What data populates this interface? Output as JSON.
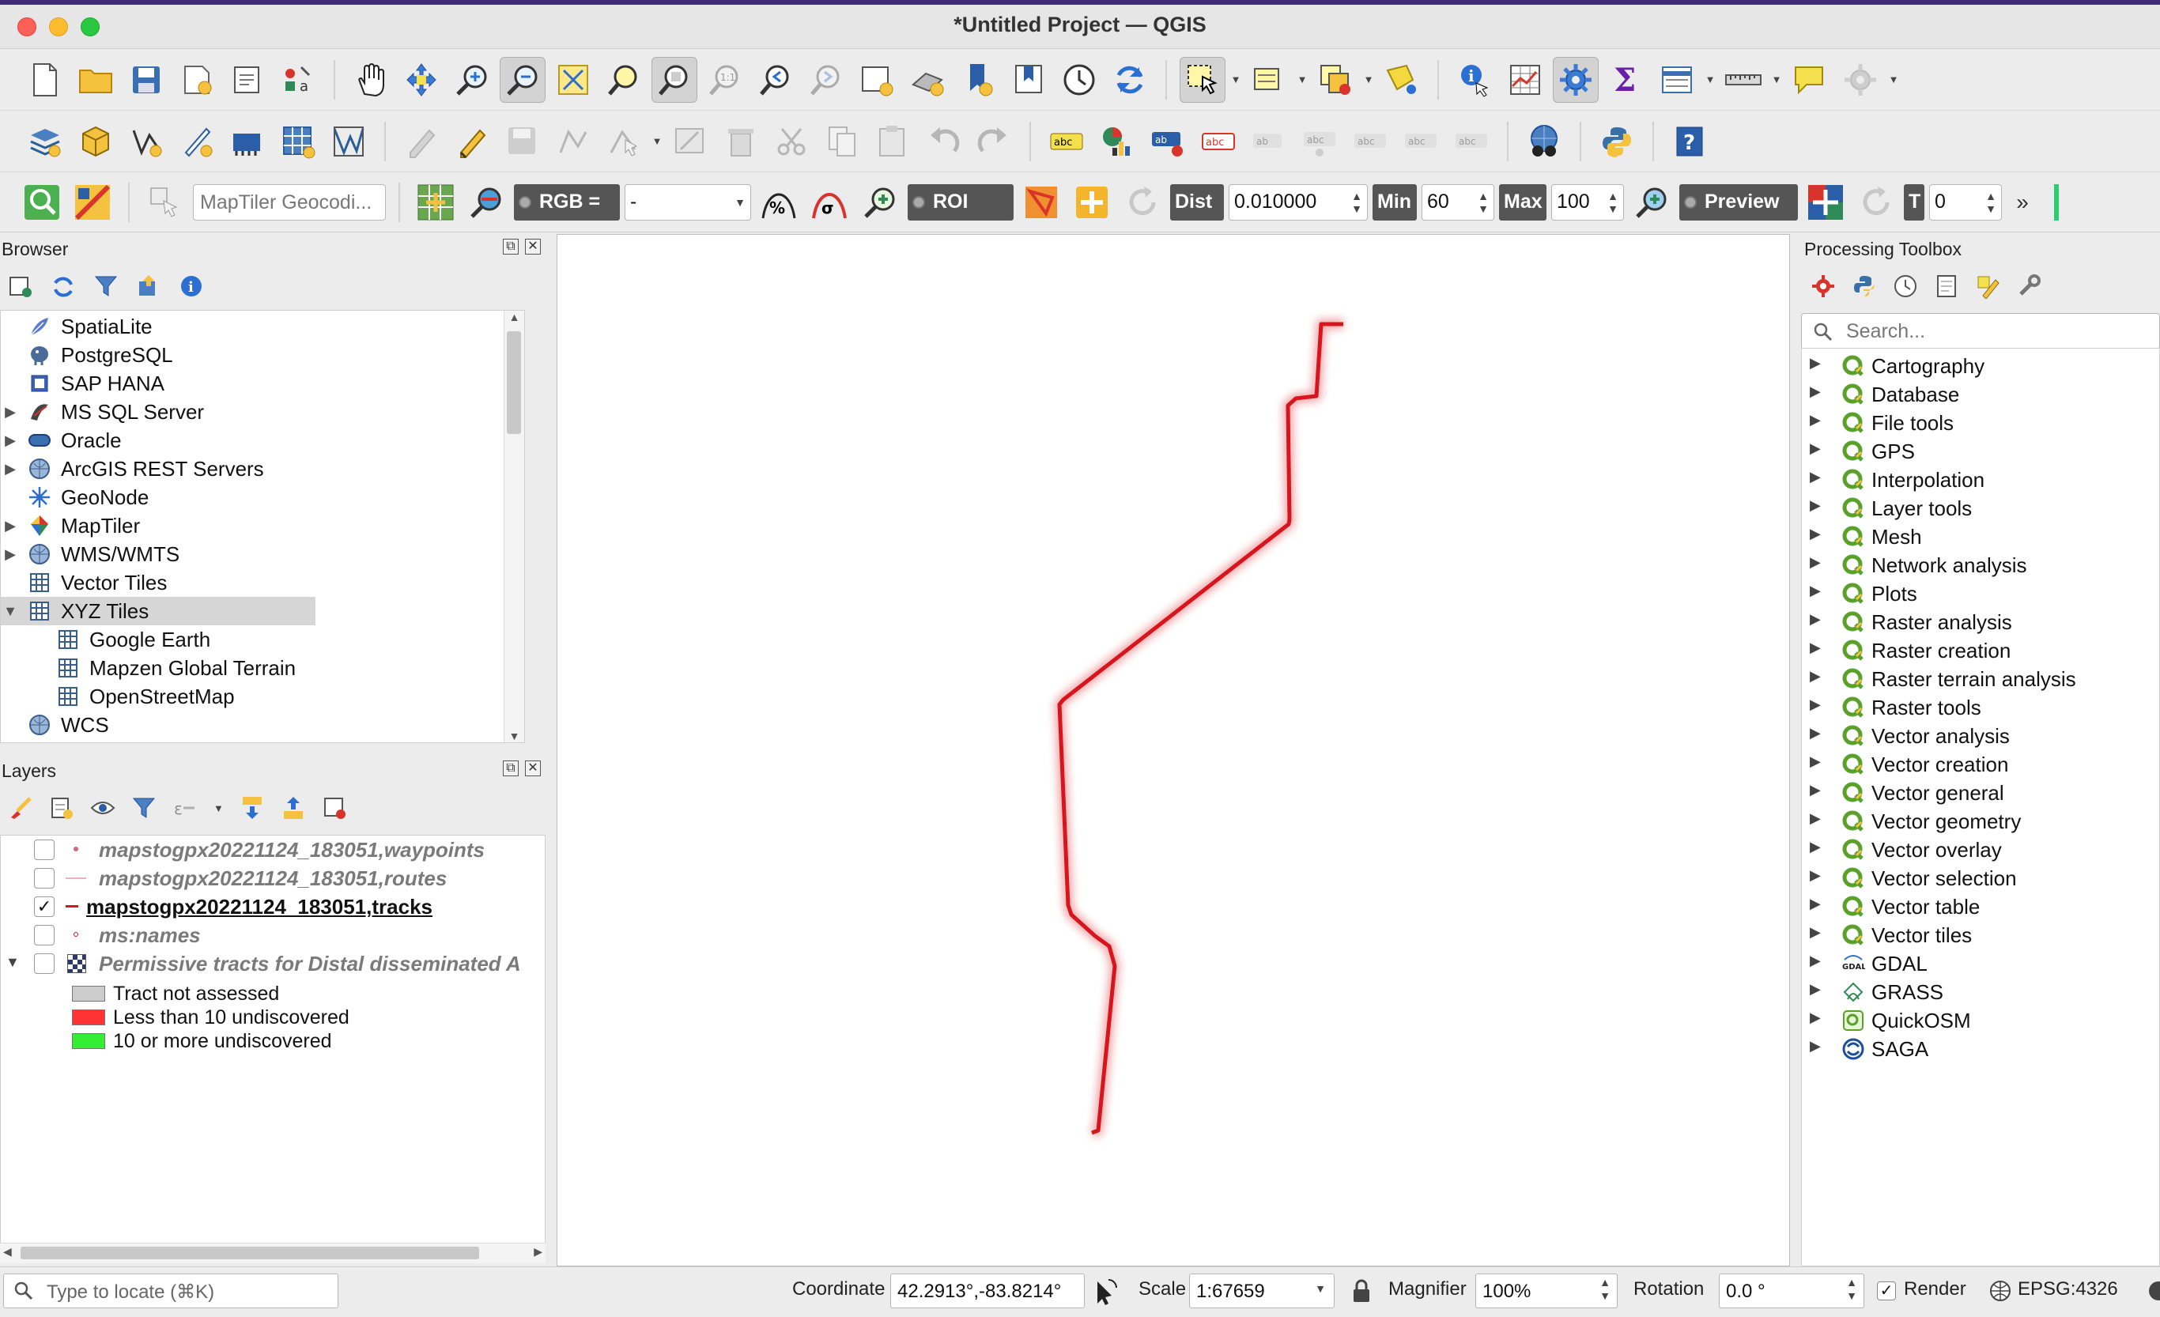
{
  "window": {
    "title": "*Untitled Project — QGIS"
  },
  "toolbar3": {
    "geocoder_placeholder": "MapTiler Geocodi...",
    "rgb_label": "RGB =",
    "rgb_value": "-",
    "roi_label": "ROI",
    "dist_label": "Dist",
    "dist_value": "0.010000",
    "min_label": "Min",
    "min_value": "60",
    "max_label": "Max",
    "max_value": "100",
    "preview_label": "Preview",
    "t_label": "T",
    "t_value": "0",
    "overflow": "»"
  },
  "browser": {
    "title": "Browser",
    "items": [
      {
        "label": "SpatiaLite",
        "icon": "feather-icon",
        "expandable": false,
        "indent": 0
      },
      {
        "label": "PostgreSQL",
        "icon": "elephant-icon",
        "expandable": false,
        "indent": 0
      },
      {
        "label": "SAP HANA",
        "icon": "database-icon",
        "expandable": false,
        "indent": 0
      },
      {
        "label": "MS SQL Server",
        "icon": "mssql-icon",
        "expandable": true,
        "indent": 0
      },
      {
        "label": "Oracle",
        "icon": "oracle-icon",
        "expandable": true,
        "indent": 0
      },
      {
        "label": "ArcGIS REST Servers",
        "icon": "globe-icon",
        "expandable": true,
        "indent": 0
      },
      {
        "label": "GeoNode",
        "icon": "geonode-icon",
        "expandable": false,
        "indent": 0
      },
      {
        "label": "MapTiler",
        "icon": "maptiler-icon",
        "expandable": true,
        "indent": 0
      },
      {
        "label": "WMS/WMTS",
        "icon": "globe-icon",
        "expandable": true,
        "indent": 0
      },
      {
        "label": "Vector Tiles",
        "icon": "grid-icon",
        "expandable": false,
        "indent": 0
      },
      {
        "label": "XYZ Tiles",
        "icon": "grid-icon",
        "expandable": true,
        "expanded": true,
        "selected": true,
        "indent": 0
      },
      {
        "label": "Google Earth",
        "icon": "grid-icon",
        "expandable": false,
        "indent": 1
      },
      {
        "label": "Mapzen Global Terrain",
        "icon": "grid-icon",
        "expandable": false,
        "indent": 1
      },
      {
        "label": "OpenStreetMap",
        "icon": "grid-icon",
        "expandable": false,
        "indent": 1
      },
      {
        "label": "WCS",
        "icon": "globe-icon",
        "expandable": false,
        "indent": 0
      }
    ]
  },
  "layers": {
    "title": "Layers",
    "items": [
      {
        "label": "mapstogpx20221124_183051,waypoints",
        "checked": false,
        "style": "dim",
        "symbol": "point-pink"
      },
      {
        "label": "mapstogpx20221124_183051,routes",
        "checked": false,
        "style": "dim",
        "symbol": "line-pink"
      },
      {
        "label": "mapstogpx20221124_183051,tracks",
        "checked": true,
        "style": "active",
        "symbol": "line-red"
      },
      {
        "label": "ms:names",
        "checked": false,
        "style": "dim",
        "symbol": "point-red"
      },
      {
        "label": "Permissive tracts for Distal disseminated A",
        "checked": false,
        "style": "dim",
        "symbol": "raster",
        "group": true
      }
    ],
    "legend": [
      {
        "label": "Tract not assessed",
        "color": "#cccccc"
      },
      {
        "label": "Less than 10 undiscovered",
        "color": "#ff3333"
      },
      {
        "label": "10 or more undiscovered",
        "color": "#33ee33"
      }
    ]
  },
  "map": {
    "track_color": "#d8141c"
  },
  "processing": {
    "title": "Processing Toolbox",
    "search_placeholder": "Search...",
    "items": [
      {
        "label": "Cartography",
        "icon": "qgis-icon"
      },
      {
        "label": "Database",
        "icon": "qgis-icon"
      },
      {
        "label": "File tools",
        "icon": "qgis-icon"
      },
      {
        "label": "GPS",
        "icon": "qgis-icon"
      },
      {
        "label": "Interpolation",
        "icon": "qgis-icon"
      },
      {
        "label": "Layer tools",
        "icon": "qgis-icon"
      },
      {
        "label": "Mesh",
        "icon": "qgis-icon"
      },
      {
        "label": "Network analysis",
        "icon": "qgis-icon"
      },
      {
        "label": "Plots",
        "icon": "qgis-icon"
      },
      {
        "label": "Raster analysis",
        "icon": "qgis-icon"
      },
      {
        "label": "Raster creation",
        "icon": "qgis-icon"
      },
      {
        "label": "Raster terrain analysis",
        "icon": "qgis-icon"
      },
      {
        "label": "Raster tools",
        "icon": "qgis-icon"
      },
      {
        "label": "Vector analysis",
        "icon": "qgis-icon"
      },
      {
        "label": "Vector creation",
        "icon": "qgis-icon"
      },
      {
        "label": "Vector general",
        "icon": "qgis-icon"
      },
      {
        "label": "Vector geometry",
        "icon": "qgis-icon"
      },
      {
        "label": "Vector overlay",
        "icon": "qgis-icon"
      },
      {
        "label": "Vector selection",
        "icon": "qgis-icon"
      },
      {
        "label": "Vector table",
        "icon": "qgis-icon"
      },
      {
        "label": "Vector tiles",
        "icon": "qgis-icon"
      },
      {
        "label": "GDAL",
        "icon": "gdal-icon"
      },
      {
        "label": "GRASS",
        "icon": "grass-icon"
      },
      {
        "label": "QuickOSM",
        "icon": "quickosm-icon"
      },
      {
        "label": "SAGA",
        "icon": "saga-icon"
      }
    ]
  },
  "status": {
    "locate_placeholder": "Type to locate (⌘K)",
    "coordinate_label": "Coordinate",
    "coordinate_value": "42.2913°,-83.8214°",
    "scale_label": "Scale",
    "scale_value": "1:67659",
    "magnifier_label": "Magnifier",
    "magnifier_value": "100%",
    "rotation_label": "Rotation",
    "rotation_value": "0.0 °",
    "render_label": "Render",
    "render_checked": true,
    "crs_label": "EPSG:4326"
  }
}
